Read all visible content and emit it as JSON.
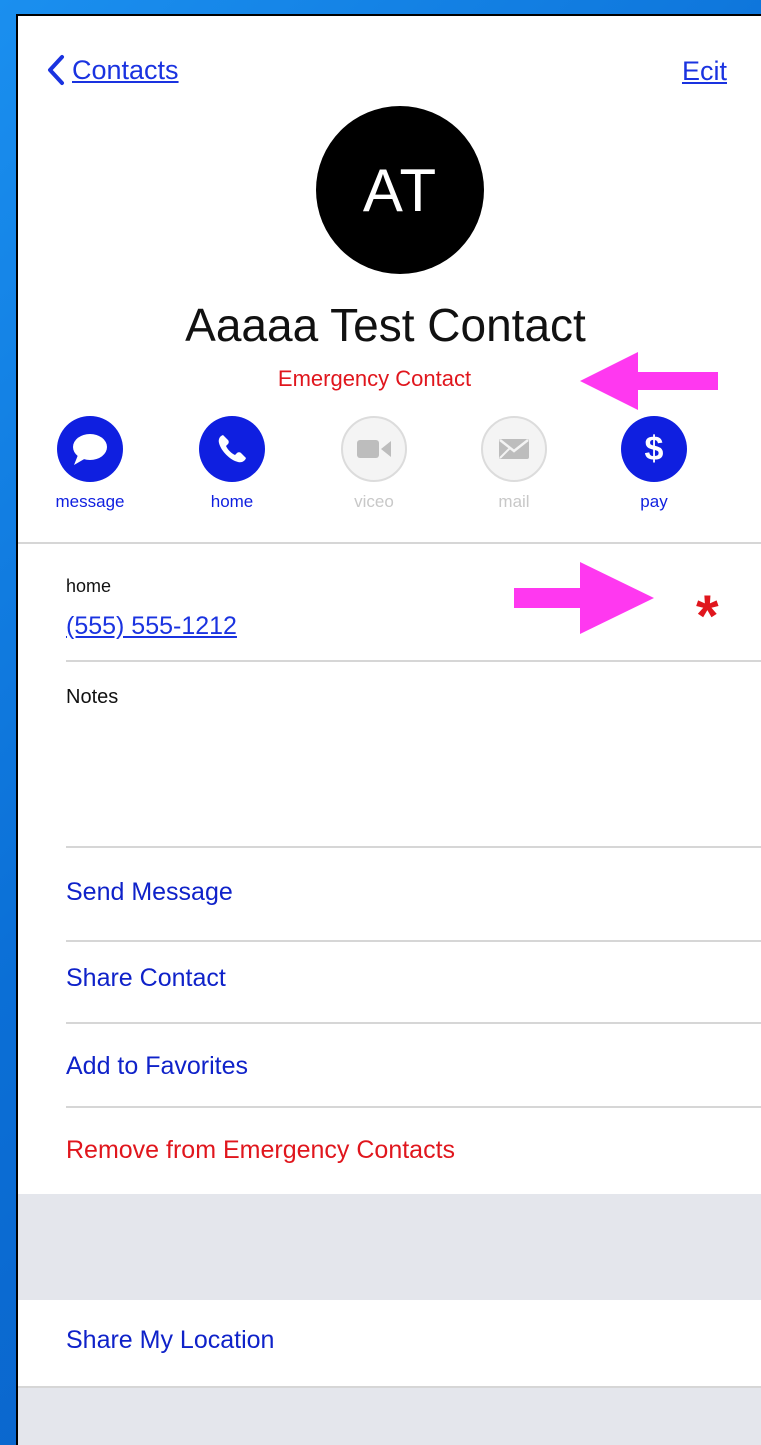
{
  "nav": {
    "back_label": "Contacts",
    "edit_label": "Ecit"
  },
  "contact": {
    "initials": "AT",
    "name": "Aaaaa Test Contact",
    "subtitle": "Emergency Contact"
  },
  "actions": [
    {
      "label": "message",
      "icon": "message-bubble-icon",
      "enabled": true
    },
    {
      "label": "home",
      "icon": "phone-icon",
      "enabled": true
    },
    {
      "label": "viceo",
      "icon": "video-camera-icon",
      "enabled": false
    },
    {
      "label": "mail",
      "icon": "envelope-icon",
      "enabled": false
    },
    {
      "label": "pay",
      "icon": "dollar-icon",
      "enabled": true
    }
  ],
  "phone": {
    "label": "home",
    "number": "(555) 555-1212",
    "marker": "*"
  },
  "notes": {
    "label": "Notes"
  },
  "list": {
    "send_message": "Send Message",
    "share_contact": "Share Contact",
    "add_favorites": "Add to Favorites",
    "remove_emergency": "Remove from Emergency Contacts",
    "share_location": "Share My Location"
  },
  "colors": {
    "accent_blue": "#0f1fe0",
    "emergency_red": "#e0161d",
    "annotation_pink": "#ff38f0",
    "background_blue": "#0b6fd6"
  }
}
